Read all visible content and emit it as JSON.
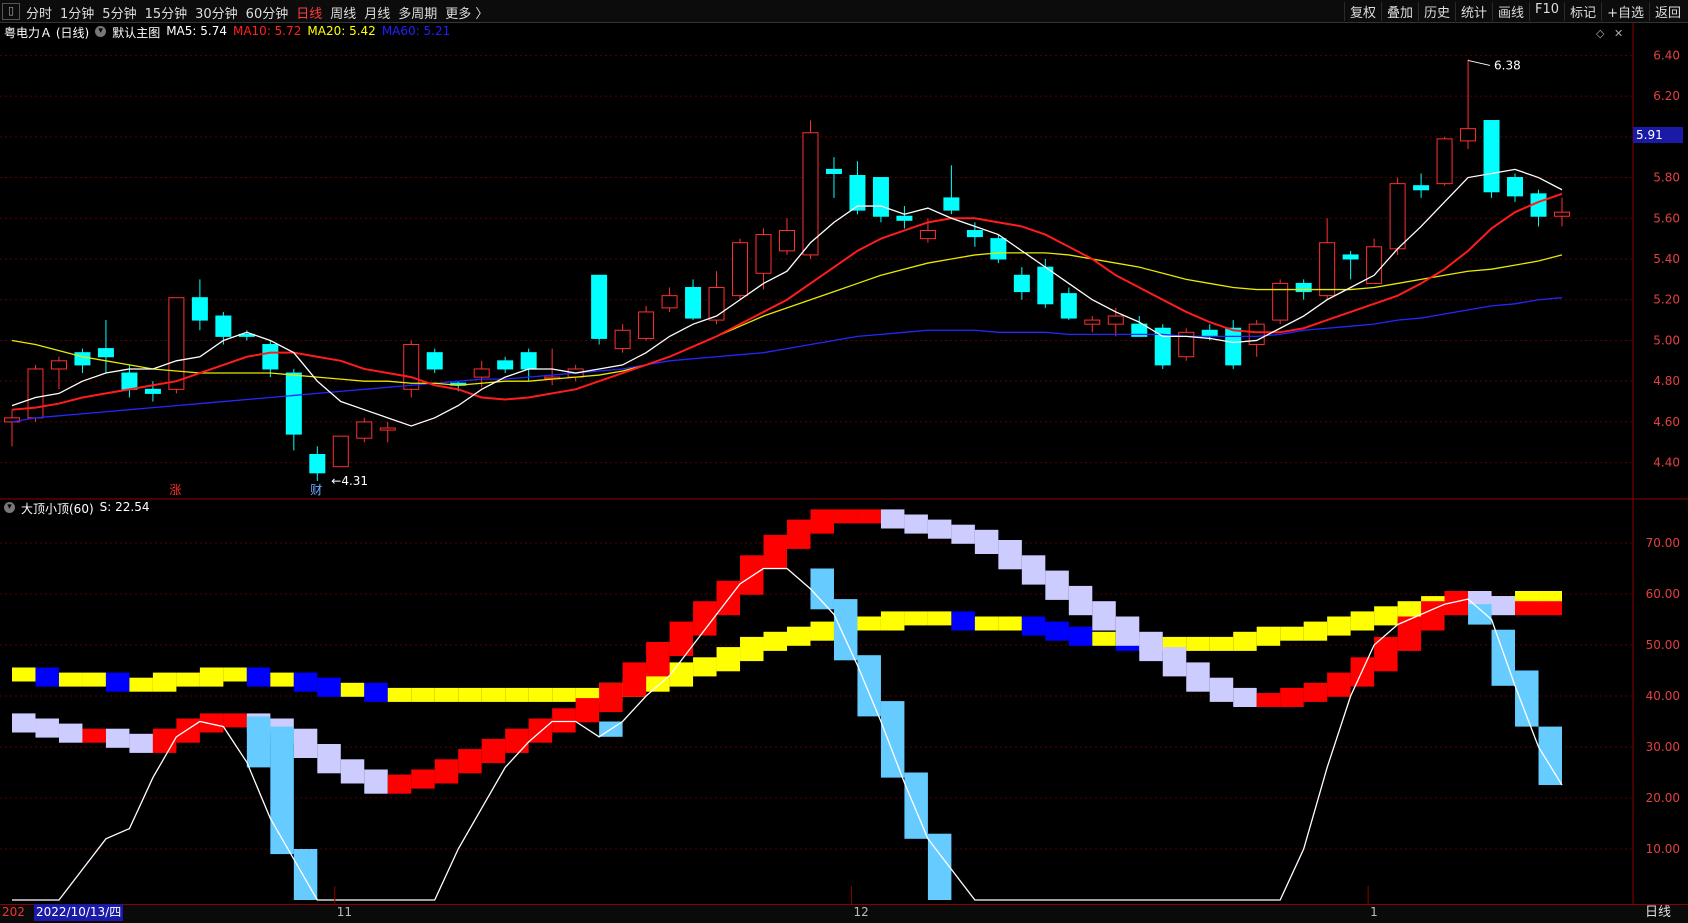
{
  "toolbar": {
    "left_items": [
      "分时",
      "1分钟",
      "5分钟",
      "15分钟",
      "30分钟",
      "60分钟",
      "日线",
      "周线",
      "月线",
      "多周期",
      "更多 〉"
    ],
    "active_item": "日线",
    "right_items": [
      "复权",
      "叠加",
      "历史",
      "统计",
      "画线",
      "F10",
      "标记",
      "+自选",
      "返回"
    ]
  },
  "main_chart": {
    "stock_name": "粤电力Ａ (日线)",
    "template": "默认主图",
    "ma_labels": [
      {
        "text": "MA5: 5.74",
        "color": "#ffffff"
      },
      {
        "text": "MA10: 5.72",
        "color": "#ff2020"
      },
      {
        "text": "MA20: 5.42",
        "color": "#ffff00"
      },
      {
        "text": "MA60: 5.21",
        "color": "#2020ff"
      }
    ],
    "y_ticks": [
      "6.40",
      "6.20",
      "6.00",
      "5.80",
      "5.60",
      "5.40",
      "5.20",
      "5.00",
      "4.80",
      "4.60",
      "4.40"
    ],
    "current_price": "5.91",
    "high_label": "6.38",
    "low_label": "4.31",
    "markers": [
      {
        "text": "涨",
        "color": "#ff3030",
        "bar": 7
      },
      {
        "text": "财",
        "color": "#6fb0ff",
        "bar": 13
      }
    ]
  },
  "indicator": {
    "title": "大顶小顶(60)",
    "value": "S: 22.54",
    "y_ticks": [
      "70.00",
      "60.00",
      "50.00",
      "40.00",
      "30.00",
      "20.00",
      "10.00"
    ]
  },
  "x_axis": {
    "left_partial": "202",
    "current_date": "2022/10/13/四",
    "ticks": [
      {
        "label": "11",
        "bar": 14
      },
      {
        "label": "12",
        "bar": 36
      },
      {
        "label": "1",
        "bar": 58
      }
    ],
    "period": "日线"
  },
  "chart_data": {
    "type": "candlestick",
    "y_range": [
      4.3,
      6.5
    ],
    "candles": [
      [
        4.6,
        4.62,
        4.48,
        4.66
      ],
      [
        4.62,
        4.86,
        4.6,
        4.88
      ],
      [
        4.86,
        4.9,
        4.76,
        4.92
      ],
      [
        4.94,
        4.88,
        4.84,
        4.96
      ],
      [
        4.96,
        4.92,
        4.84,
        5.1
      ],
      [
        4.84,
        4.76,
        4.72,
        4.88
      ],
      [
        4.76,
        4.74,
        4.7,
        4.8
      ],
      [
        4.76,
        5.21,
        4.74,
        5.21
      ],
      [
        5.21,
        5.1,
        5.05,
        5.3
      ],
      [
        5.12,
        5.02,
        4.98,
        5.14
      ],
      [
        5.03,
        5.02,
        5.0,
        5.05
      ],
      [
        4.98,
        4.86,
        4.82,
        5.0
      ],
      [
        4.84,
        4.54,
        4.46,
        4.86
      ],
      [
        4.44,
        4.35,
        4.31,
        4.48
      ],
      [
        4.38,
        4.53,
        4.38,
        4.53
      ],
      [
        4.52,
        4.6,
        4.5,
        4.62
      ],
      [
        4.56,
        4.57,
        4.5,
        4.6
      ],
      [
        4.76,
        4.98,
        4.72,
        5.0
      ],
      [
        4.94,
        4.86,
        4.84,
        4.96
      ],
      [
        4.79,
        4.78,
        4.75,
        4.8
      ],
      [
        4.82,
        4.86,
        4.77,
        4.9
      ],
      [
        4.9,
        4.86,
        4.84,
        4.92
      ],
      [
        4.94,
        4.86,
        4.8,
        4.96
      ],
      [
        4.82,
        4.82,
        4.78,
        4.96
      ],
      [
        4.82,
        4.86,
        4.8,
        4.88
      ],
      [
        5.32,
        5.01,
        4.98,
        5.32
      ],
      [
        4.96,
        5.05,
        4.94,
        5.08
      ],
      [
        5.01,
        5.14,
        5.0,
        5.17
      ],
      [
        5.16,
        5.22,
        5.14,
        5.26
      ],
      [
        5.26,
        5.11,
        5.1,
        5.3
      ],
      [
        5.1,
        5.26,
        5.08,
        5.34
      ],
      [
        5.22,
        5.48,
        5.2,
        5.5
      ],
      [
        5.33,
        5.52,
        5.25,
        5.55
      ],
      [
        5.44,
        5.54,
        5.42,
        5.6
      ],
      [
        5.42,
        6.02,
        5.4,
        6.08
      ],
      [
        5.84,
        5.82,
        5.7,
        5.9
      ],
      [
        5.81,
        5.64,
        5.62,
        5.88
      ],
      [
        5.8,
        5.61,
        5.58,
        5.8
      ],
      [
        5.61,
        5.59,
        5.55,
        5.66
      ],
      [
        5.5,
        5.54,
        5.48,
        5.6
      ],
      [
        5.7,
        5.64,
        5.62,
        5.86
      ],
      [
        5.54,
        5.51,
        5.46,
        5.58
      ],
      [
        5.5,
        5.4,
        5.38,
        5.52
      ],
      [
        5.32,
        5.24,
        5.2,
        5.36
      ],
      [
        5.36,
        5.18,
        5.16,
        5.4
      ],
      [
        5.23,
        5.11,
        5.1,
        5.26
      ],
      [
        5.08,
        5.1,
        5.04,
        5.12
      ],
      [
        5.08,
        5.12,
        5.02,
        5.16
      ],
      [
        5.08,
        5.02,
        5.02,
        5.12
      ],
      [
        5.06,
        4.88,
        4.86,
        5.08
      ],
      [
        4.92,
        5.04,
        4.9,
        5.06
      ],
      [
        5.05,
        5.02,
        5.0,
        5.08
      ],
      [
        5.06,
        4.88,
        4.86,
        5.1
      ],
      [
        4.98,
        5.08,
        4.92,
        5.1
      ],
      [
        5.1,
        5.28,
        5.08,
        5.3
      ],
      [
        5.28,
        5.24,
        5.2,
        5.3
      ],
      [
        5.22,
        5.48,
        5.2,
        5.6
      ],
      [
        5.42,
        5.4,
        5.3,
        5.44
      ],
      [
        5.28,
        5.46,
        5.28,
        5.5
      ],
      [
        5.45,
        5.77,
        5.42,
        5.8
      ],
      [
        5.76,
        5.74,
        5.7,
        5.82
      ],
      [
        5.77,
        5.99,
        5.76,
        6.0
      ],
      [
        5.98,
        6.04,
        5.94,
        6.38
      ],
      [
        6.08,
        5.73,
        5.7,
        6.08
      ],
      [
        5.8,
        5.71,
        5.68,
        5.82
      ],
      [
        5.72,
        5.61,
        5.56,
        5.74
      ],
      [
        5.61,
        5.63,
        5.56,
        5.7
      ]
    ],
    "ma5": [
      4.68,
      4.72,
      4.74,
      4.8,
      4.84,
      4.86,
      4.86,
      4.9,
      4.92,
      5.0,
      5.04,
      5.0,
      4.94,
      4.8,
      4.7,
      4.66,
      4.62,
      4.58,
      4.62,
      4.68,
      4.76,
      4.82,
      4.86,
      4.86,
      4.84,
      4.86,
      4.88,
      4.94,
      5.02,
      5.08,
      5.12,
      5.2,
      5.28,
      5.34,
      5.48,
      5.58,
      5.66,
      5.66,
      5.62,
      5.65,
      5.6,
      5.56,
      5.52,
      5.44,
      5.36,
      5.28,
      5.2,
      5.14,
      5.09,
      5.02,
      5.02,
      5.01,
      4.99,
      5.0,
      5.06,
      5.12,
      5.2,
      5.26,
      5.32,
      5.45,
      5.56,
      5.68,
      5.8,
      5.82,
      5.84,
      5.8,
      5.74
    ],
    "ma10": [
      4.66,
      4.67,
      4.69,
      4.72,
      4.74,
      4.76,
      4.78,
      4.8,
      4.84,
      4.88,
      4.92,
      4.94,
      4.94,
      4.92,
      4.9,
      4.86,
      4.84,
      4.82,
      4.78,
      4.76,
      4.72,
      4.71,
      4.72,
      4.74,
      4.76,
      4.8,
      4.84,
      4.88,
      4.92,
      4.97,
      5.02,
      5.08,
      5.14,
      5.2,
      5.28,
      5.36,
      5.44,
      5.5,
      5.54,
      5.58,
      5.6,
      5.6,
      5.58,
      5.56,
      5.52,
      5.46,
      5.4,
      5.32,
      5.26,
      5.2,
      5.14,
      5.09,
      5.05,
      5.04,
      5.04,
      5.06,
      5.1,
      5.14,
      5.18,
      5.22,
      5.28,
      5.35,
      5.44,
      5.55,
      5.63,
      5.68,
      5.72
    ],
    "ma20": [
      5.0,
      4.98,
      4.95,
      4.92,
      4.9,
      4.88,
      4.86,
      4.85,
      4.84,
      4.84,
      4.84,
      4.84,
      4.83,
      4.82,
      4.81,
      4.8,
      4.8,
      4.79,
      4.79,
      4.78,
      4.79,
      4.8,
      4.8,
      4.81,
      4.82,
      4.83,
      4.85,
      4.88,
      4.92,
      4.97,
      5.02,
      5.07,
      5.12,
      5.16,
      5.2,
      5.24,
      5.28,
      5.32,
      5.35,
      5.38,
      5.4,
      5.42,
      5.43,
      5.43,
      5.43,
      5.42,
      5.4,
      5.38,
      5.36,
      5.33,
      5.3,
      5.28,
      5.26,
      5.25,
      5.25,
      5.25,
      5.25,
      5.25,
      5.26,
      5.28,
      5.3,
      5.32,
      5.34,
      5.35,
      5.37,
      5.39,
      5.42
    ],
    "ma60": [
      4.6,
      4.62,
      4.63,
      4.64,
      4.65,
      4.66,
      4.67,
      4.68,
      4.69,
      4.7,
      4.71,
      4.72,
      4.73,
      4.74,
      4.75,
      4.76,
      4.77,
      4.78,
      4.79,
      4.8,
      4.81,
      4.81,
      4.82,
      4.83,
      4.84,
      4.85,
      4.86,
      4.88,
      4.9,
      4.91,
      4.92,
      4.93,
      4.94,
      4.96,
      4.98,
      5.0,
      5.02,
      5.03,
      5.04,
      5.05,
      5.05,
      5.05,
      5.04,
      5.04,
      5.04,
      5.03,
      5.03,
      5.03,
      5.03,
      5.03,
      5.02,
      5.02,
      5.02,
      5.02,
      5.03,
      5.05,
      5.06,
      5.07,
      5.08,
      5.1,
      5.11,
      5.13,
      5.15,
      5.17,
      5.18,
      5.2,
      5.21
    ],
    "indicator_range": [
      0,
      80
    ],
    "ind_fast": [
      36,
      35,
      34,
      33,
      33,
      32,
      31,
      33,
      35,
      36,
      36,
      35,
      33,
      30,
      27,
      25,
      23,
      24,
      25,
      27,
      29,
      31,
      33,
      35,
      37,
      39,
      42,
      46,
      50,
      54,
      58,
      62,
      67,
      71,
      74,
      76,
      76,
      76,
      75,
      74,
      73,
      72,
      70,
      67,
      64,
      61,
      58,
      55,
      52,
      49,
      46,
      43,
      41,
      40,
      40,
      41,
      42,
      44,
      47,
      51,
      55,
      58,
      60,
      59,
      58,
      58,
      58
    ],
    "ind_slow": [
      45,
      45,
      44,
      44,
      44,
      43,
      43,
      44,
      44,
      45,
      45,
      44,
      44,
      43,
      42,
      42,
      41,
      41,
      41,
      41,
      41,
      41,
      41,
      41,
      41,
      41,
      42,
      43,
      44,
      46,
      47,
      49,
      51,
      52,
      53,
      54,
      55,
      55,
      56,
      56,
      56,
      55,
      55,
      55,
      54,
      53,
      52,
      52,
      51,
      51,
      51,
      51,
      51,
      52,
      53,
      53,
      54,
      55,
      56,
      57,
      58,
      59,
      60,
      59,
      59,
      60,
      60
    ],
    "ind_s": [
      0,
      0,
      0,
      6,
      12,
      14,
      24,
      32,
      35,
      34,
      27,
      16,
      8,
      0,
      0,
      0,
      0,
      0,
      0,
      10,
      18,
      26,
      31,
      35,
      35,
      32,
      35,
      40,
      44,
      50,
      56,
      62,
      65,
      65,
      61,
      56,
      46,
      35,
      23,
      12,
      6,
      0,
      0,
      0,
      0,
      0,
      0,
      0,
      0,
      0,
      0,
      0,
      0,
      0,
      0,
      10,
      26,
      40,
      50,
      54,
      56,
      58,
      59,
      55,
      42,
      30,
      22.54
    ],
    "ind_s_blocks": [
      {
        "from": 10,
        "to": 11,
        "top": 36,
        "bottom": 26
      },
      {
        "from": 11,
        "to": 12,
        "top": 34,
        "bottom": 9
      },
      {
        "from": 12,
        "to": 13,
        "top": 10,
        "bottom": 0
      },
      {
        "from": 25,
        "to": 26,
        "top": 35,
        "bottom": 32
      },
      {
        "from": 34,
        "to": 35,
        "top": 65,
        "bottom": 57
      },
      {
        "from": 35,
        "to": 36,
        "top": 59,
        "bottom": 47
      },
      {
        "from": 36,
        "to": 37,
        "top": 48,
        "bottom": 36
      },
      {
        "from": 37,
        "to": 38,
        "top": 39,
        "bottom": 24
      },
      {
        "from": 38,
        "to": 39,
        "top": 25,
        "bottom": 12
      },
      {
        "from": 39,
        "to": 40,
        "top": 13,
        "bottom": 0
      },
      {
        "from": 62,
        "to": 63,
        "top": 58,
        "bottom": 54
      },
      {
        "from": 63,
        "to": 64,
        "top": 53,
        "bottom": 42
      },
      {
        "from": 64,
        "to": 65,
        "top": 45,
        "bottom": 34
      },
      {
        "from": 65,
        "to": 66,
        "top": 34,
        "bottom": 22.54
      }
    ]
  }
}
